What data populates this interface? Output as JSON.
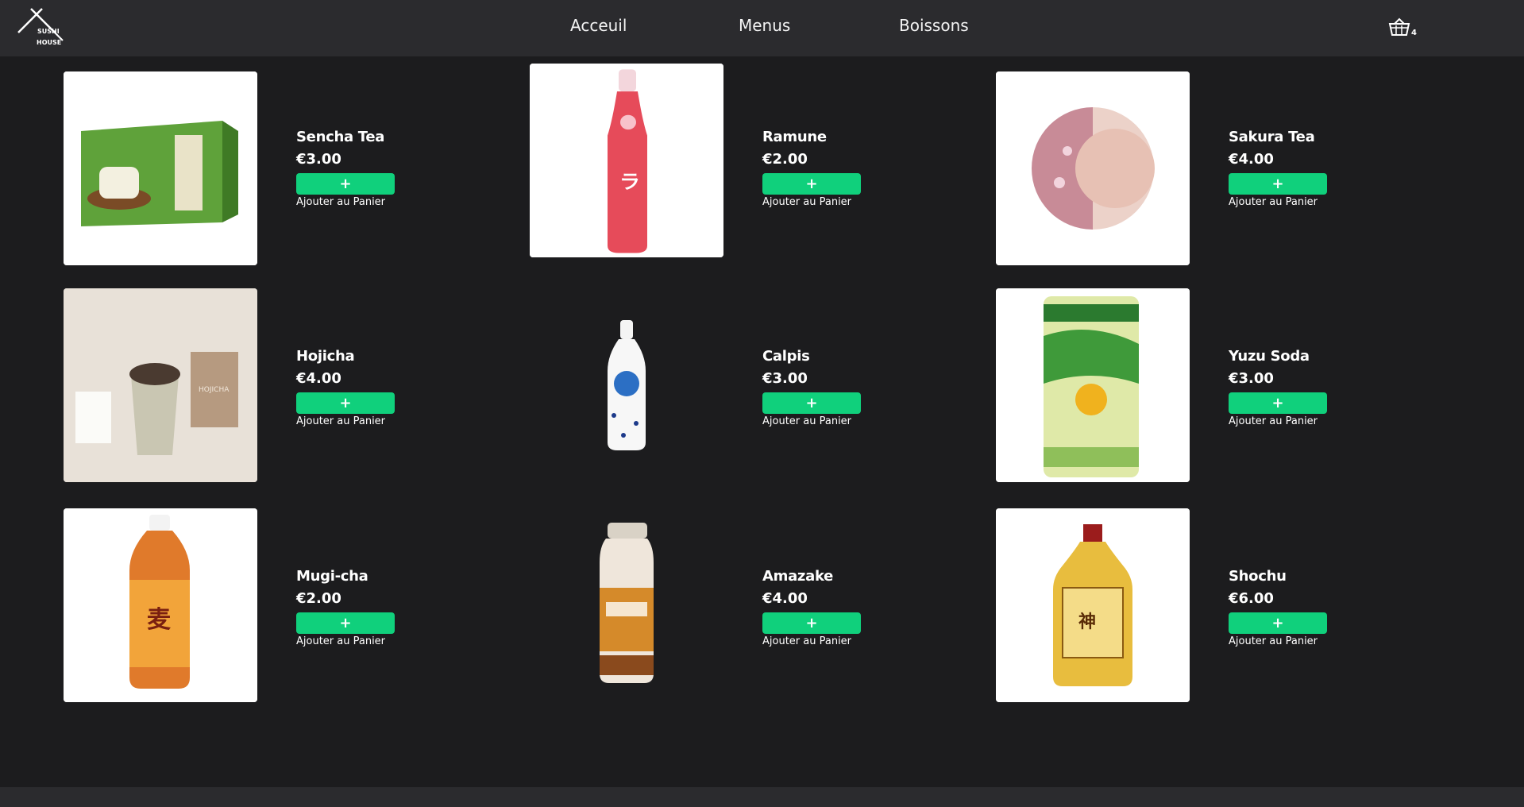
{
  "brand": {
    "logo_line1": "SUSHI",
    "logo_line2": "HOUSE"
  },
  "nav": {
    "home": "Acceuil",
    "menus": "Menus",
    "drinks": "Boissons"
  },
  "cart": {
    "count": "4",
    "icon": "basket-icon"
  },
  "colors": {
    "background": "#1c1c1e",
    "navbar": "#2b2b2e",
    "accent": "#10d07c"
  },
  "products": [
    {
      "name": "Sencha Tea",
      "price": "€3.00",
      "button": "+",
      "action": "Ajouter au Panier"
    },
    {
      "name": "Ramune",
      "price": "€2.00",
      "button": "+",
      "action": "Ajouter au Panier"
    },
    {
      "name": "Sakura Tea",
      "price": "€4.00",
      "button": "+",
      "action": "Ajouter au Panier"
    },
    {
      "name": "Hojicha",
      "price": "€4.00",
      "button": "+",
      "action": "Ajouter au Panier"
    },
    {
      "name": "Calpis",
      "price": "€3.00",
      "button": "+",
      "action": "Ajouter au Panier"
    },
    {
      "name": "Yuzu Soda",
      "price": "€3.00",
      "button": "+",
      "action": "Ajouter au Panier"
    },
    {
      "name": "Mugi-cha",
      "price": "€2.00",
      "button": "+",
      "action": "Ajouter au Panier"
    },
    {
      "name": "Amazake",
      "price": "€4.00",
      "button": "+",
      "action": "Ajouter au Panier"
    },
    {
      "name": "Shochu",
      "price": "€6.00",
      "button": "+",
      "action": "Ajouter au Panier"
    }
  ]
}
